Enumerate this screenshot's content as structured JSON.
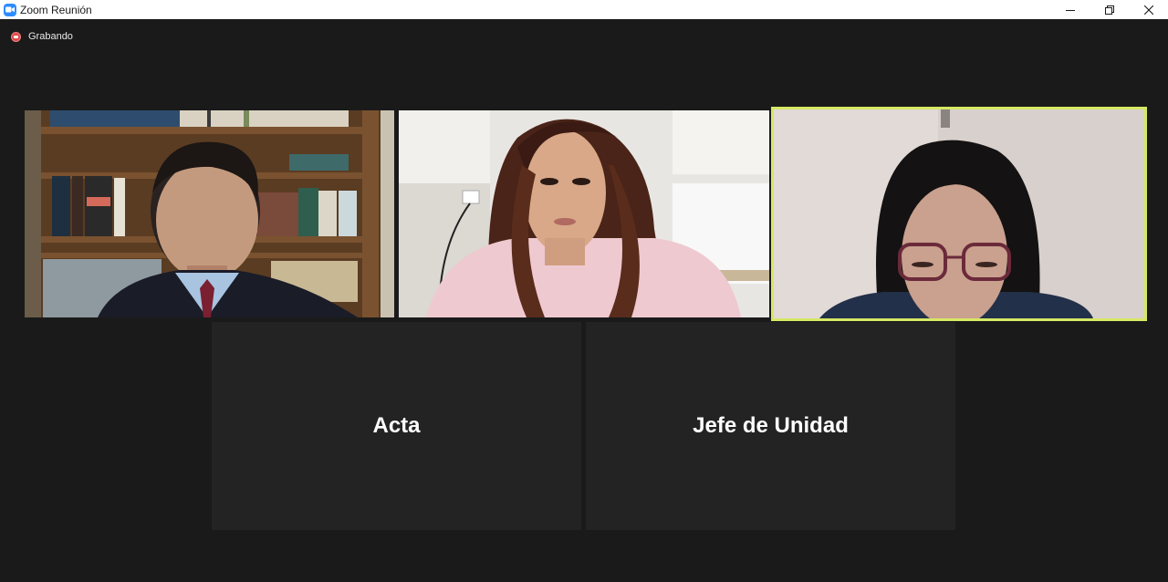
{
  "window": {
    "title": "Zoom Reunión",
    "app_icon": "zoom-camera-icon",
    "controls": [
      "minimize-icon",
      "restore-icon",
      "close-icon"
    ]
  },
  "recording": {
    "label": "Grabando",
    "icon": "recording-icon",
    "color": "#e04848"
  },
  "participants": {
    "video_tiles": [
      {
        "id": "participant-1",
        "video": "man in suit in front of bookshelf"
      },
      {
        "id": "participant-2",
        "video": "young woman in pink in kitchen"
      },
      {
        "id": "participant-3",
        "video": "woman with glasses, active speaker",
        "active_speaker": true
      }
    ],
    "name_tiles": [
      {
        "name": "Acta"
      },
      {
        "name": "Jefe de Unidad"
      }
    ]
  },
  "colors": {
    "background": "#1a1a1a",
    "name_tile": "#232323",
    "active_speaker_border": "#d6e864",
    "titlebar": "#ffffff"
  }
}
